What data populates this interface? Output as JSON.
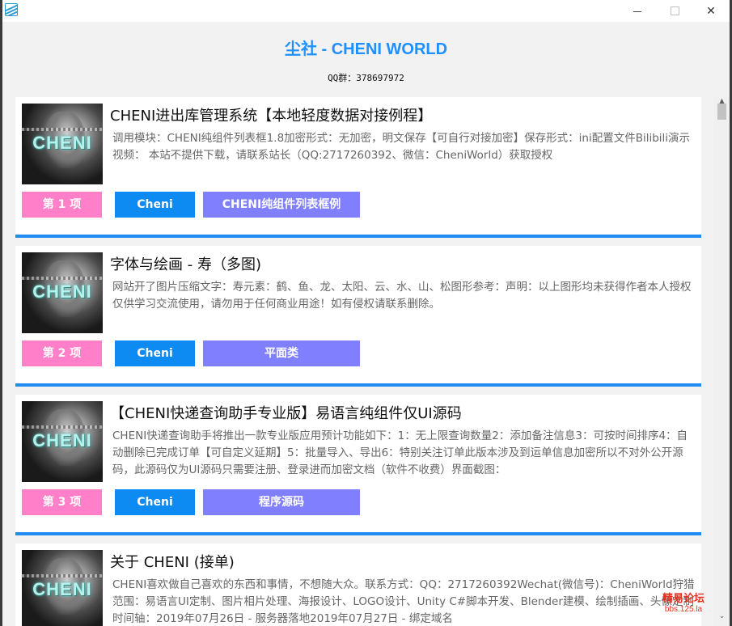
{
  "window": {
    "minimize_glyph": "",
    "maximize_glyph": "",
    "close_glyph": "✕"
  },
  "app": {
    "title": "尘社 - CHENI WORLD",
    "qq": "QQ群：378697972"
  },
  "items": [
    {
      "thumb_text": "CHENI",
      "title": "CHENI进出库管理系统【本地轻度数据对接例程】",
      "desc": "调用模块：CHENI纯组件列表框1.8加密形式：无加密，明文保存【可自行对接加密】保存形式：ini配置文件Bilibili演示视频： 本站不提供下载，请联系站长（QQ:2717260392、微信：CheniWorld）获取授权",
      "index_label": "第 1 项",
      "author": "Cheni",
      "category": "CHENI纯组件列表框例"
    },
    {
      "thumb_text": "CHENI",
      "title": "字体与绘画 - 寿（多图)",
      "desc": "网站开了图片压缩文字：寿元素：鹤、鱼、龙、太阳、云、水、山、松图形参考：声明：以上图形均未获得作者本人授权仅供学习交流使用，请勿用于任何商业用途！如有侵权请联系删除。",
      "index_label": "第 2 项",
      "author": "Cheni",
      "category": "平面类"
    },
    {
      "thumb_text": "CHENI",
      "title": "【CHENI快递查询助手专业版】易语言纯组件仅UI源码",
      "desc": "CHENI快递查询助手将推出一款专业版应用预计功能如下：1：无上限查询数量2：添加备注信息3：可按时间排序4：自动删除已完成订单【可自定义延期】5：批量导入、导出6：特别关注订单此版本涉及到运单信息加密所以不对外公开源码，此源码仅为UI源码只需要注册、登录进而加密文档（软件不收费）界面截图：",
      "index_label": "第 3 项",
      "author": "Cheni",
      "category": "程序源码"
    },
    {
      "thumb_text": "CHENI",
      "title": "关于 CHENI (接单)",
      "desc": "CHENI喜欢做自己喜欢的东西和事情，不想随大众。联系方式：QQ：2717260392Wechat(微信号)：CheniWorld狩猎范围：易语言UI定制、图片相片处理、海报设计、LOGO设计、Unity C#脚本开发、Blender建模、绘制插画、头像定制时间轴：2019年07月26日 - 服务器落地2019年07月27日 - 绑定域名",
      "index_label": "",
      "author": "",
      "category": ""
    }
  ],
  "scrollbar": {
    "up_glyph": "▲",
    "down_glyph": "⌄"
  },
  "watermark": {
    "main": "精易论坛",
    "sub": "bbs.125.la"
  },
  "colors": {
    "accent": "#1e90ff",
    "separator": "#1e8cf0",
    "tag_pink": "#ff7fc8",
    "tag_blue": "#0d8bf2",
    "tag_purple": "#8080ff"
  }
}
